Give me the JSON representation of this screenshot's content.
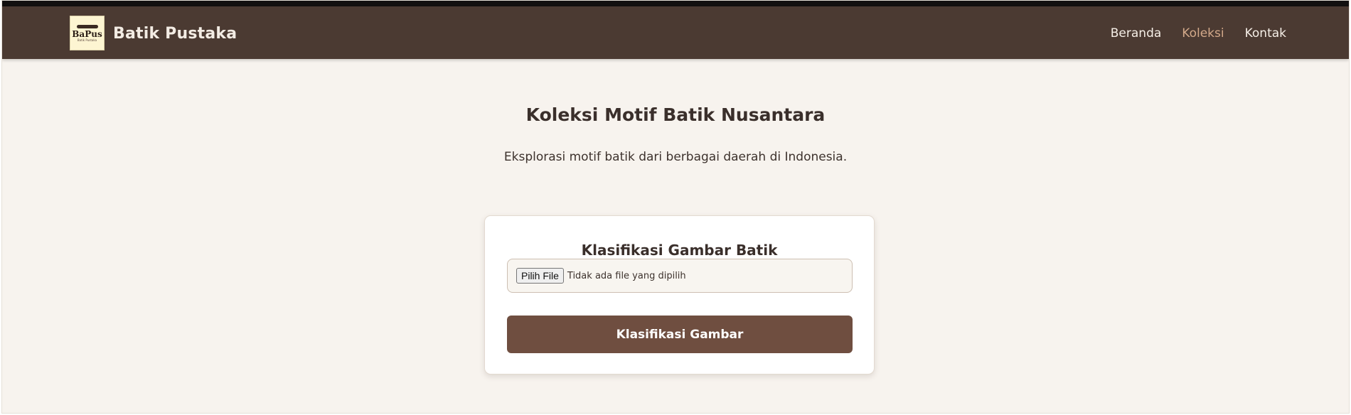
{
  "navbar": {
    "logo": {
      "text": "BaPus",
      "subtext": "Batik Pustaka",
      "icon": "batik-logo-icon"
    },
    "brand": "Batik Pustaka",
    "links": [
      {
        "label": "Beranda",
        "active": false
      },
      {
        "label": "Koleksi",
        "active": true
      },
      {
        "label": "Kontak",
        "active": false
      }
    ]
  },
  "hero": {
    "title": "Koleksi Motif Batik Nusantara",
    "subtitle": "Eksplorasi motif batik dari berbagai daerah di Indonesia."
  },
  "classifier": {
    "title": "Klasifikasi Gambar Batik",
    "file_button_label": "Pilih File",
    "file_status": "Tidak ada file yang dipilih",
    "submit_label": "Klasifikasi Gambar"
  },
  "colors": {
    "navbar": "#4b3a32",
    "accent_active": "#d3a98a",
    "primary_button": "#6f4e40",
    "background": "#f7f3ee"
  }
}
